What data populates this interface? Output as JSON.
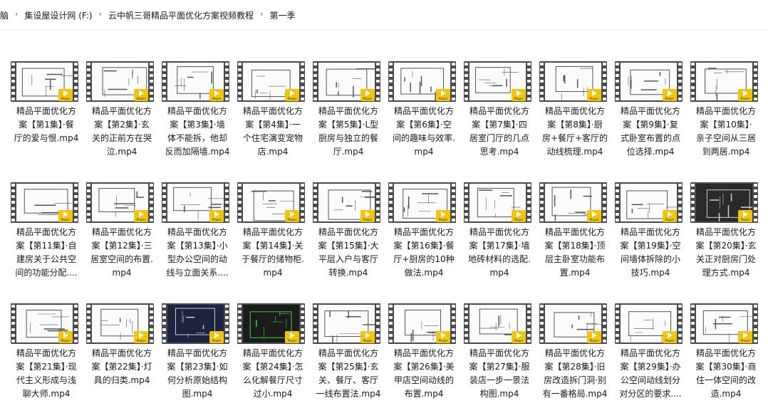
{
  "breadcrumb": {
    "items": [
      "脑",
      "集设屋设计网 (F:)",
      "云中帆三哥精品平面优化方案视频教程",
      "第一季"
    ],
    "separator": "›"
  },
  "badge_label": "Player",
  "files": [
    {
      "lines": [
        "精品平面优化方",
        "案【第1集】·餐",
        "厅的爱与恨.mp4"
      ]
    },
    {
      "lines": [
        "精品平面优化方",
        "案【第2集】·玄",
        "关的正前方在哭",
        "泣.mp4"
      ]
    },
    {
      "lines": [
        "精品平面优化方",
        "案【第3集】·墙",
        "体不能拆，他却",
        "反而加隔墙.mp4"
      ]
    },
    {
      "lines": [
        "精品平面优化方",
        "案【第4集】·一",
        "个住宅演变宠物",
        "店.mp4"
      ]
    },
    {
      "lines": [
        "精品平面优化方",
        "案【第5集】·L型",
        "厨房与独立的餐",
        "厅.mp4"
      ]
    },
    {
      "lines": [
        "精品平面优化方",
        "案【第6集】·空",
        "间的趣味与效率.",
        "mp4"
      ]
    },
    {
      "lines": [
        "精品平面优化方",
        "案【第7集】·四",
        "居室门厅的几点",
        "思考.mp4"
      ]
    },
    {
      "lines": [
        "精品平面优化方",
        "案【第8集】·厨",
        "房+餐厅+客厅的",
        "动线梳理.mp4"
      ]
    },
    {
      "lines": [
        "精品平面优化方",
        "案【第9集】·复",
        "式卧室布置的点",
        "位选择.mp4"
      ]
    },
    {
      "lines": [
        "精品平面优化方",
        "案【第10集】·",
        "亲子空间从三居",
        "到两居.mp4"
      ]
    },
    {
      "lines": [
        "精品平面优化方",
        "案【第11集】·自",
        "建房关于公共空",
        "间的功能分配...."
      ]
    },
    {
      "lines": [
        "精品平面优化方",
        "案【第12集】·三",
        "居室空间的布置.",
        "mp4"
      ]
    },
    {
      "lines": [
        "精品平面优化方",
        "案【第13集】·小",
        "型办公空间的动",
        "线与立面关系...."
      ]
    },
    {
      "lines": [
        "精品平面优化方",
        "案【第14集】·关",
        "于餐厅的储物柜.",
        "mp4"
      ]
    },
    {
      "lines": [
        "精品平面优化方",
        "案【第15集】·大",
        "平层入户与客厅",
        "转换.mp4"
      ]
    },
    {
      "lines": [
        "精品平面优化方",
        "案【第16集】·餐",
        "厅+厨房的10种",
        "做法.mp4"
      ]
    },
    {
      "lines": [
        "精品平面优化方",
        "案【第17集】·墙",
        "地砖材料的选配.",
        "mp4"
      ]
    },
    {
      "lines": [
        "精品平面优化方",
        "案【第18集】·顶",
        "层主卧室功能布",
        "置.mp4"
      ]
    },
    {
      "lines": [
        "精品平面优化方",
        "案【第19集】·空",
        "间墙体拆除的小",
        "技巧.mp4"
      ]
    },
    {
      "lines": [
        "精品平面优化方",
        "案【第20集】·玄",
        "关正对厨房门处",
        "理方式.mp4"
      ]
    },
    {
      "lines": [
        "精品平面优化方",
        "案【第21集】·现",
        "代主义形成与浅",
        "聊大师.mp4"
      ]
    },
    {
      "lines": [
        "精品平面优化方",
        "案【第22集】·灯",
        "具的归类.mp4"
      ]
    },
    {
      "lines": [
        "精品平面优化方",
        "案【第23集】·如",
        "何分析原始结构",
        "图.mp4"
      ]
    },
    {
      "lines": [
        "精品平面优化方",
        "案【第24集】·怎",
        "么化解餐厅尺寸",
        "过小.mp4"
      ]
    },
    {
      "lines": [
        "精品平面优化方",
        "案【第25集】·玄",
        "关、餐厅、客厅",
        "一线布置法.mp4"
      ]
    },
    {
      "lines": [
        "精品平面优化方",
        "案【第26集】·美",
        "甲店空间动线的",
        "布置.mp4"
      ]
    },
    {
      "lines": [
        "精品平面优化方",
        "案【第27集】·服",
        "装店一步一景法",
        "构图.mp4"
      ]
    },
    {
      "lines": [
        "精品平面优化方",
        "案【第28集】·旧",
        "房改造拆门洞·别",
        "有一番格局.mp4"
      ]
    },
    {
      "lines": [
        "精品平面优化方",
        "案【第29集】·办",
        "公空间动线划分",
        "对分区的要求...."
      ]
    },
    {
      "lines": [
        "精品平面优化方",
        "案【第30集】·商",
        "住一体空间的改",
        "造.mp4"
      ]
    }
  ]
}
